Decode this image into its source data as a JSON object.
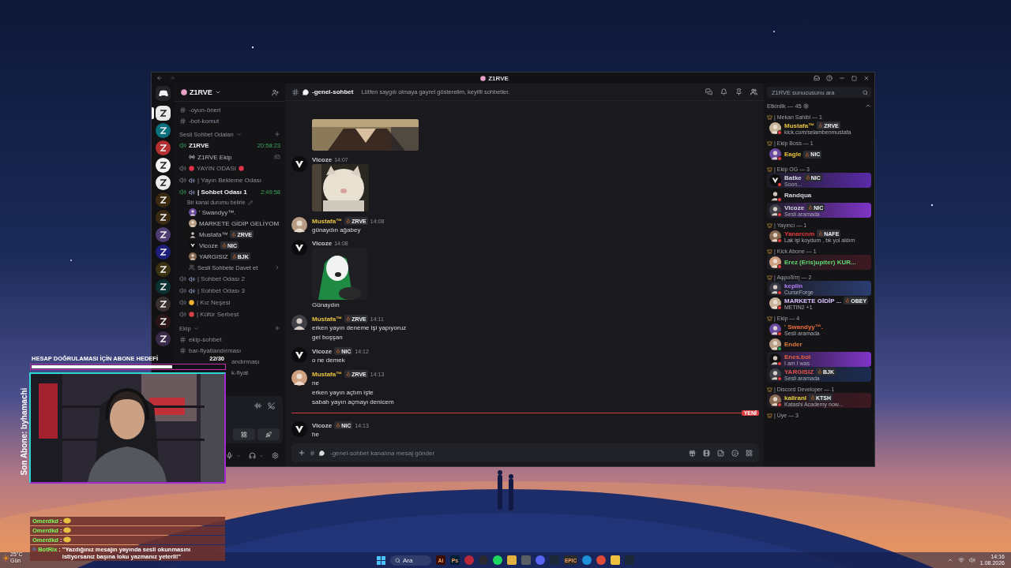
{
  "window": {
    "title": "Z1RVE"
  },
  "servers": [
    {
      "selected": true
    },
    {
      "selected": false
    },
    {
      "selected": false
    },
    {
      "selected": false
    },
    {
      "selected": false
    },
    {
      "selected": false
    },
    {
      "selected": false
    },
    {
      "selected": false
    },
    {
      "selected": false
    },
    {
      "selected": false
    },
    {
      "selected": false
    },
    {
      "selected": false
    },
    {
      "selected": false
    },
    {
      "selected": false
    }
  ],
  "server": {
    "name": "Z1RVE"
  },
  "channels": [
    {
      "kind": "text",
      "name": "-oyun-öneri"
    },
    {
      "kind": "text",
      "name": "-bot-komut"
    },
    {
      "kind": "category",
      "name": "Sesli Sohbet Odaları"
    },
    {
      "kind": "voice",
      "name": "Z1RVE",
      "active": true,
      "timer": "20:58:23"
    },
    {
      "kind": "event",
      "name": "Z1RVE Ekip"
    },
    {
      "kind": "voice-live",
      "name": "YAYIN ODASI",
      "active": false
    },
    {
      "kind": "voice-room",
      "name": "| Yayın Bekleme Odası",
      "active": false
    },
    {
      "kind": "voice-room",
      "name": "| Sohbet Odası 1",
      "active": true,
      "timer": "2:49:58"
    },
    {
      "kind": "status",
      "name": "Bir kanal durumu belirle"
    },
    {
      "kind": "user",
      "name": "' Swandyy™."
    },
    {
      "kind": "user",
      "name": "MARKETE GİDİP GELİYOM"
    },
    {
      "kind": "user",
      "name": "Mustafa™",
      "tag": "ZRVE"
    },
    {
      "kind": "user",
      "name": "Vicoze",
      "tag": "NIC"
    },
    {
      "kind": "user",
      "name": "YARGISIZ",
      "tag": "BJK"
    },
    {
      "kind": "invite",
      "name": "Sesli Sohbete Davet et"
    },
    {
      "kind": "voice-room",
      "name": "| Sohbet Odası 2",
      "active": false
    },
    {
      "kind": "voice-room",
      "name": "| Sohbet Odası 3",
      "active": false
    },
    {
      "kind": "voice-sun",
      "name": "| Kız Neşesi",
      "active": false
    },
    {
      "kind": "voice-angry",
      "name": "| Küfür Serbest",
      "active": false
    },
    {
      "kind": "category",
      "name": "Ekip"
    },
    {
      "kind": "text",
      "name": "ekip-sohbet"
    },
    {
      "kind": "text",
      "name": "bar-fiyatlandırması"
    },
    {
      "kind": "partial",
      "name": "andırması"
    },
    {
      "kind": "partial",
      "name": "k-fiyat"
    }
  ],
  "chat": {
    "channel": "-genel-sohbet",
    "topic": "Lütfen saygılı olmaya gayret gösterelim, keyifli sohbetler.",
    "placeholder": "-genel-sohbet kanalına mesaj gönder"
  },
  "messages": [
    {
      "attachment": {
        "kind": "picture"
      }
    },
    {
      "author": "Vicoze",
      "color": "#c9ccd4",
      "time": "14:07",
      "attachment": {
        "kind": "picture"
      }
    },
    {
      "author": "Mustafa™",
      "color": "#e8c341",
      "tag": "ZRVE",
      "time": "14:08",
      "lines": [
        "günaydın ağabey"
      ]
    },
    {
      "author": "Vicoze",
      "color": "#c9ccd4",
      "time": "14:08",
      "attachment": {
        "kind": "picture"
      },
      "lines": [
        "Günaydın"
      ]
    },
    {
      "author": "Mustafa™",
      "color": "#e8c341",
      "tag": "ZRVE",
      "time": "14:11",
      "lines": [
        "erken yayın deneme işi yapıyoruz",
        "gel boşşan"
      ]
    },
    {
      "author": "Vicoze",
      "color": "#c9ccd4",
      "tag": "NIC",
      "time": "14:12",
      "lines": [
        "o ne demek"
      ]
    },
    {
      "author": "Mustafa™",
      "color": "#e8c341",
      "tag": "ZRVE",
      "time": "14:13",
      "lines": [
        "ne",
        "erken yayın açtım işte",
        "sabah yayın açmayı denicem"
      ]
    },
    {
      "kind": "new-divider",
      "label": "YENİ"
    },
    {
      "author": "Vicoze",
      "color": "#c9ccd4",
      "tag": "NIC",
      "time": "14:13",
      "lines": [
        "he"
      ]
    }
  ],
  "members": {
    "search_placeholder": "Z1RVE sunucusunu ara",
    "activity": "Etkinlik — 45",
    "groups": [
      {
        "title": "| Mekan Sahibi — 1",
        "members": [
          {
            "name": "Mustafa™",
            "color": "#e8c341",
            "tag": "ZRVE",
            "dnd": true,
            "activity": "kick.com/selambenmustafa"
          }
        ]
      },
      {
        "title": "| Ekip Boss — 1",
        "members": [
          {
            "name": "Eagle",
            "color": "#e8c341",
            "tag": "NIC",
            "dnd": true
          }
        ]
      },
      {
        "title": "| Ekip OG — 3",
        "members": [
          {
            "name": "Batke",
            "color": "#d6dae4",
            "tag": "NIC",
            "dnd": true,
            "activity": "Soon...",
            "nameplate": true
          },
          {
            "name": "Randqua",
            "color": "#d6dae4",
            "dnd": true
          },
          {
            "name": "Vicoze",
            "color": "#d6dae4",
            "tag": "NIC",
            "dnd": true,
            "activity": "Sesli aramada",
            "nameplate": true
          }
        ]
      },
      {
        "title": "| Yayıncı — 1",
        "members": [
          {
            "name": "Yanarcnm",
            "color": "#e23b3b",
            "tag": "NAFE",
            "dnd": true,
            "activity": "Lak işi koydum , bk yol aldım"
          }
        ]
      },
      {
        "title": "| Kick Abone — 1",
        "members": [
          {
            "name": "Erez (Eris)upiter) KUR...",
            "color": "#5fd970",
            "dnd": true,
            "nameplate": true
          }
        ]
      },
      {
        "title": "| Αφροδίτη — 2",
        "members": [
          {
            "name": "keplin",
            "color": "#b47cf0",
            "dnd": true,
            "activity": "CurseForge",
            "nameplate": true
          },
          {
            "name": "MARKETE GİDİP ...",
            "color": "#d9c2ff",
            "tag": "OBEY",
            "dnd": true,
            "activity": "METIN2 +1"
          }
        ]
      },
      {
        "title": "| Ekip — 4",
        "members": [
          {
            "name": "' Swandyy™.",
            "color": "#ea6a3c",
            "dnd": true,
            "activity": "Sesli aramada"
          },
          {
            "name": "Ender",
            "color": "#e07a3a",
            "dnd": false
          },
          {
            "name": "Enes.boi",
            "color": "#e8603f",
            "dnd": true,
            "activity": "I am I was",
            "nameplate": true
          },
          {
            "name": "YARGISIZ",
            "color": "#e85050",
            "tag": "BJK",
            "dnd": true,
            "activity": "Sesli aramada",
            "nameplate": true
          }
        ]
      },
      {
        "title": "| Discord Developer — 1",
        "members": [
          {
            "name": "kaliranl",
            "color": "#e8d040",
            "tag": "KTSH",
            "dnd": true,
            "activity": "Katashi Academy now...",
            "nameplate": true
          }
        ]
      },
      {
        "title": "| Üye — 3"
      }
    ]
  },
  "overlay": {
    "goal": {
      "title": "HESAP DOĞRULAMASI İÇİN ABONE HEDEFİ",
      "count": "22/30",
      "level": 0.73
    },
    "last_sub": "Son Abone: byhamachi",
    "camera": {
      "kind": "picture"
    },
    "chat": [
      {
        "user": "Omerdkd",
        "separator": ":",
        "emote": true
      },
      {
        "user": "Omerdkd",
        "separator": ":",
        "emote": true
      },
      {
        "user": "Omerdkd",
        "separator": ":",
        "emote": true
      },
      {
        "user": "BotRix",
        "separator": ":",
        "text": "\"Yazdığınız mesajın yayında sesli okunmasını istiyorsanız başına loku yazmanız yeterli!\""
      }
    ]
  },
  "weather": {
    "temp": "25°C",
    "desc": "Gün"
  },
  "taskbar": {
    "search": "Ara",
    "apps": [
      {
        "kind": "label",
        "label": "Ai",
        "color": "#3a0d05"
      },
      {
        "kind": "label",
        "label": "Ps",
        "color": "#001e36"
      },
      {
        "kind": "dot",
        "color": "#b8283a"
      },
      {
        "kind": "dot",
        "color": "#2a2a30"
      },
      {
        "kind": "dot",
        "color": "#1ed760"
      },
      {
        "kind": "tile",
        "color": "#e0b040"
      },
      {
        "kind": "tile",
        "color": "#5a5f66"
      },
      {
        "kind": "dot",
        "color": "#5865f2"
      },
      {
        "kind": "tile",
        "color": "#1b2838"
      },
      {
        "kind": "label",
        "label": "EPIC",
        "color": "#2a2a2a"
      },
      {
        "kind": "dot",
        "color": "#1e90d8"
      },
      {
        "kind": "dot",
        "color": "#e04a3a"
      },
      {
        "kind": "tile",
        "color": "#f0c040"
      },
      {
        "kind": "tile",
        "color": "#1b2838"
      }
    ],
    "time": "14:16",
    "date": "1.08.2026"
  }
}
